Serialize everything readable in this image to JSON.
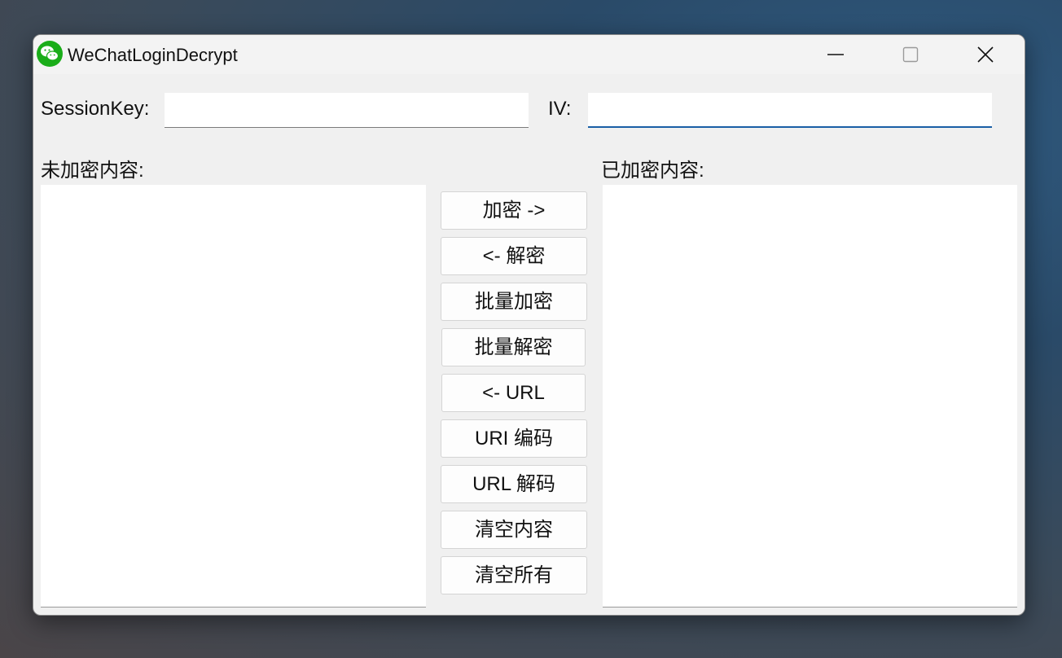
{
  "window": {
    "title": "WeChatLoginDecrypt",
    "icon": "wechat-icon",
    "controls": [
      "minimize-icon",
      "maximize-icon",
      "close-icon"
    ]
  },
  "session_key": {
    "label": "SessionKey:",
    "value": ""
  },
  "iv": {
    "label": "IV:",
    "value": ""
  },
  "plain_panel": {
    "label": "未加密内容:",
    "value": ""
  },
  "encrypted_panel": {
    "label": "已加密内容:",
    "value": ""
  },
  "buttons": {
    "encrypt": "加密 ->",
    "decrypt": "<- 解密",
    "batch_encrypt": "批量加密",
    "batch_decrypt": "批量解密",
    "url": "<- URL",
    "uri_encode": "URI 编码",
    "url_decode": "URL 解码",
    "clear_content": "清空内容",
    "clear_all": "清空所有"
  },
  "colors": {
    "accent": "#1a5fa6",
    "wechat_green": "#1aad19",
    "window_bg": "#f0f0f0"
  }
}
